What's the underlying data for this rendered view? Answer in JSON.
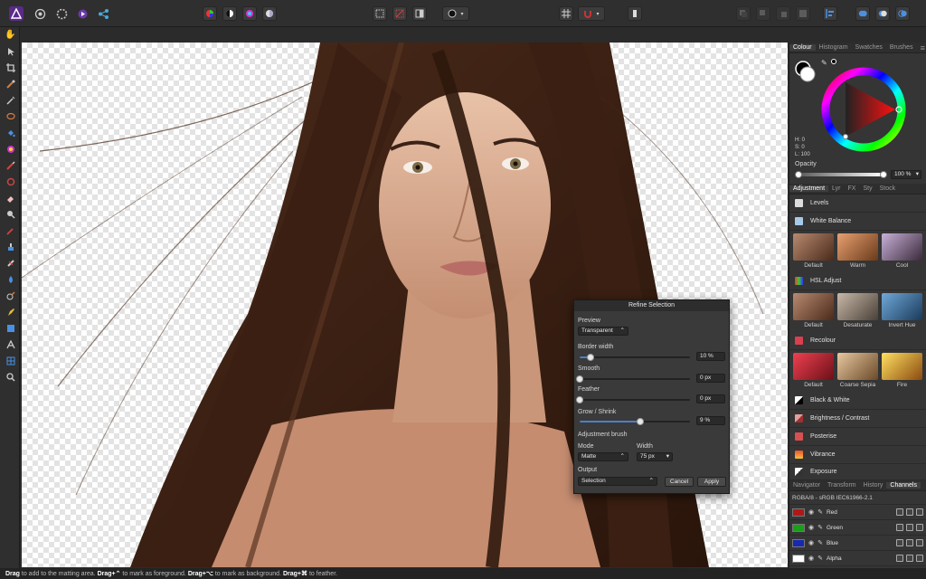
{
  "toolbar": {
    "personas": [
      "affinity-photo-icon",
      "liquify-icon",
      "develop-icon",
      "tone-mapping-icon",
      "export-icon"
    ]
  },
  "right_panel": {
    "colour_tabs": [
      "Colour",
      "Histogram",
      "Swatches",
      "Brushes"
    ],
    "hsl": {
      "h": "H: 0",
      "s": "S: 0",
      "l": "L: 100"
    },
    "opacity_label": "Opacity",
    "opacity_value": "100 %",
    "adjust_tabs": [
      "Adjustment",
      "Lyr",
      "FX",
      "Sty",
      "Stock"
    ],
    "adjustments": [
      {
        "label": "Levels",
        "color": "#dddddd"
      },
      {
        "label": "White Balance",
        "color": "#a8c8e8"
      }
    ],
    "white_balance_presets": [
      "Default",
      "Warm",
      "Cool"
    ],
    "hsl_adjust": "HSL Adjust",
    "hsl_presets": [
      "Default",
      "Desaturate",
      "Invert Hue"
    ],
    "recolour": "Recolour",
    "recolour_presets": [
      "Default",
      "Coarse Sepia",
      "Fire"
    ],
    "more_adjustments": [
      {
        "label": "Black & White",
        "color": "#cccccc"
      },
      {
        "label": "Brightness / Contrast",
        "color": "#e0a0a0"
      },
      {
        "label": "Posterise",
        "color": "#d85050"
      },
      {
        "label": "Vibrance",
        "color": "#f0a040"
      },
      {
        "label": "Exposure",
        "color": "#bbbbbb"
      }
    ],
    "bottom_tabs": [
      "Navigator",
      "Transform",
      "History",
      "Channels"
    ],
    "channel_format": "RGBA/8 - sRGB IEC61966-2.1",
    "channels": [
      {
        "name": "Red",
        "color": "#b01818"
      },
      {
        "name": "Green",
        "color": "#18a018"
      },
      {
        "name": "Blue",
        "color": "#1828b0"
      },
      {
        "name": "Alpha",
        "color": "#ffffff"
      }
    ]
  },
  "dialog": {
    "title": "Refine Selection",
    "preview_label": "Preview",
    "preview_value": "Transparent",
    "border_label": "Border width",
    "border_value": "10 %",
    "border_level": 0.1,
    "smooth_label": "Smooth",
    "smooth_value": "0 px",
    "smooth_level": 0,
    "feather_label": "Feather",
    "feather_value": "0 px",
    "feather_level": 0,
    "grow_label": "Grow / Shrink",
    "grow_value": "9 %",
    "grow_level": 0.55,
    "brush_label": "Adjustment brush",
    "mode_label": "Mode",
    "mode_value": "Matte",
    "width_label": "Width",
    "width_value": "75 px",
    "output_label": "Output",
    "output_value": "Selection",
    "cancel": "Cancel",
    "apply": "Apply"
  },
  "status": {
    "b1": "Drag",
    "t1": " to add to the matting area. ",
    "b2": "Drag+⌃",
    "t2": " to mark as foreground. ",
    "b3": "Drag+⌥",
    "t3": " to mark as background. ",
    "b4": "Drag+⌘",
    "t4": " to feather."
  }
}
